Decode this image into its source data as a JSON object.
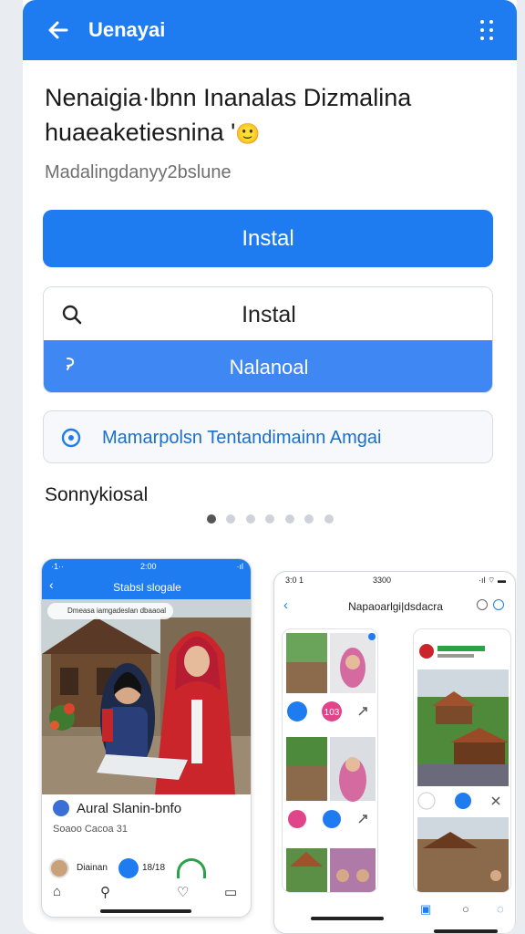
{
  "topbar": {
    "back_icon": "arrow-left-icon",
    "title": "Uenayai",
    "menu_icon": "dots-grid-icon",
    "color": "#1f7cf0"
  },
  "headline": {
    "line1": "Nenaigia·lbnn Inanalas Dizmalina",
    "line2": "huaeaketiesnina '",
    "emoji": "🙂"
  },
  "subtitle": "Madalingdanyy2bslune",
  "primary_button": {
    "label": "Instal"
  },
  "search_row": {
    "icon": "search-icon",
    "label": "Instal"
  },
  "blue_row": {
    "icon": "link-icon",
    "label": "Nalanoal"
  },
  "info_row": {
    "icon": "info-circle-icon",
    "label": "Mamarpolsn Tentandimainn Amgai"
  },
  "section_title": "Sonnykiosal",
  "carousel": {
    "count": 7,
    "active_index": 0
  },
  "phone1": {
    "status_left": "·1··",
    "status_center": "2:00",
    "status_right": "·ıl",
    "back_icon": "chevron-left-icon",
    "title": "Stabsl slogale",
    "chip": "Dmeasa iamgadeslan dbaaoal",
    "name": "Aural Slanin-bnfo",
    "sub": "Soaoo Cacoa 31",
    "footer_name": "Diainan",
    "footer_count": "18/18",
    "nav": [
      "home-icon",
      "search-icon",
      "heart-icon",
      "chat-icon"
    ]
  },
  "phone2": {
    "status_left": "3:0 1",
    "status_center": "3300",
    "status_right": "·ıl ⌔ ▬",
    "back_icon": "chevron-left-icon",
    "title": "Napaoarlgi|dsdacra",
    "badge_count": "103",
    "bottom_nav": [
      "home-icon",
      "circle-icon",
      "profile-icon"
    ]
  }
}
